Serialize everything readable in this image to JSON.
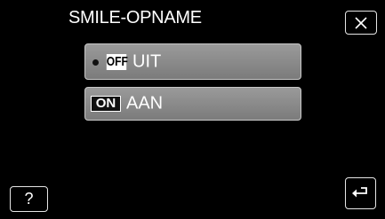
{
  "screen": {
    "title": "SMILE-OPNAME"
  },
  "options": [
    {
      "badge": "OFF",
      "label": "UIT",
      "selected": true
    },
    {
      "badge": "ON",
      "label": "AAN",
      "selected": false
    }
  ],
  "buttons": {
    "close_icon": "close-icon",
    "help_label": "?",
    "back_icon": "return-arrow-icon"
  }
}
